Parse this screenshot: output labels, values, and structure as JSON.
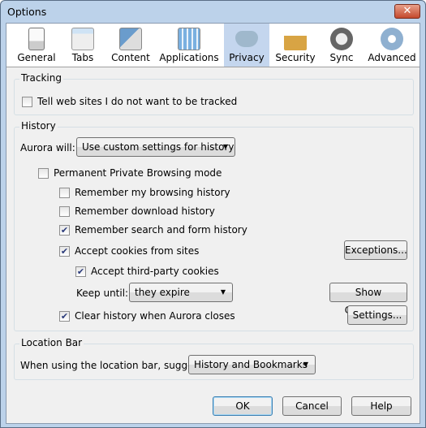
{
  "window": {
    "title": "Options",
    "close_icon": "close-icon"
  },
  "tabs": [
    {
      "label": "General",
      "icon": "switch-icon"
    },
    {
      "label": "Tabs",
      "icon": "folder-icon"
    },
    {
      "label": "Content",
      "icon": "content-icon"
    },
    {
      "label": "Applications",
      "icon": "applications-icon"
    },
    {
      "label": "Privacy",
      "icon": "mask-icon",
      "selected": true
    },
    {
      "label": "Security",
      "icon": "padlock-icon"
    },
    {
      "label": "Sync",
      "icon": "sync-icon"
    },
    {
      "label": "Advanced",
      "icon": "gear-icon"
    }
  ],
  "tracking": {
    "title": "Tracking",
    "dnt_label": "Tell web sites I do not want to be tracked",
    "dnt_checked": false
  },
  "history": {
    "title": "History",
    "will_label": "Aurora will:",
    "will_value": "Use custom settings for history",
    "private_label": "Permanent Private Browsing mode",
    "private_checked": false,
    "browsing_label": "Remember my browsing history",
    "browsing_checked": false,
    "download_label": "Remember download history",
    "download_checked": false,
    "search_label": "Remember search and form history",
    "search_checked": true,
    "cookies_label": "Accept cookies from sites",
    "cookies_checked": true,
    "exceptions_button": "Exceptions...",
    "thirdparty_label": "Accept third-party cookies",
    "thirdparty_checked": true,
    "keep_label": "Keep until:",
    "keep_value": "they expire",
    "show_cookies_button": "Show Cookies...",
    "clear_label": "Clear history when Aurora closes",
    "clear_checked": true,
    "settings_button": "Settings..."
  },
  "location": {
    "title": "Location Bar",
    "suggest_label": "When using the location bar, suggest:",
    "suggest_value": "History and Bookmarks"
  },
  "footer": {
    "ok": "OK",
    "cancel": "Cancel",
    "help": "Help"
  }
}
